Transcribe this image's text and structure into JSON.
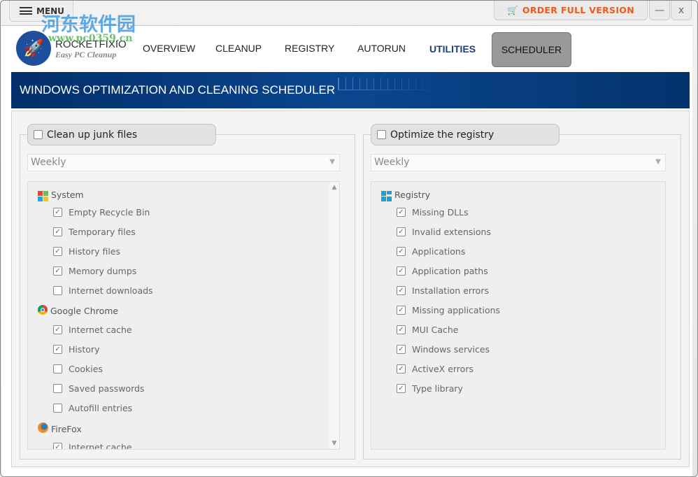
{
  "titlebar": {
    "menu_label": "MENU",
    "order_label": "ORDER FULL VERSION",
    "minimize_label": "—",
    "close_label": "x"
  },
  "watermark": {
    "text": "河东软件园",
    "url": "www.pc0359.cn"
  },
  "brand": {
    "name": "ROCKETFIXIO",
    "tagline": "Easy PC Cleanup"
  },
  "nav": [
    {
      "label": "OVERVIEW"
    },
    {
      "label": "CLEANUP"
    },
    {
      "label": "REGISTRY"
    },
    {
      "label": "AUTORUN"
    },
    {
      "label": "UTILITIES"
    },
    {
      "label": "SCHEDULER",
      "selected": true
    }
  ],
  "banner": {
    "title": "WINDOWS OPTIMIZATION AND CLEANING SCHEDULER"
  },
  "colors": {
    "accent": "#f05a1a",
    "banner": "#0a468f",
    "nav_active": "#1f3e74"
  },
  "left": {
    "label": "Clean up junk files",
    "checked": false,
    "frequency": "Weekly",
    "groups": [
      {
        "name": "System",
        "icon": "windows-icon",
        "items": [
          {
            "label": "Empty Recycle Bin",
            "checked": true
          },
          {
            "label": "Temporary files",
            "checked": true
          },
          {
            "label": "History files",
            "checked": true
          },
          {
            "label": "Memory dumps",
            "checked": true
          },
          {
            "label": "Internet downloads",
            "checked": false
          }
        ]
      },
      {
        "name": "Google Chrome",
        "icon": "chrome-icon",
        "items": [
          {
            "label": "Internet cache",
            "checked": true
          },
          {
            "label": "History",
            "checked": true
          },
          {
            "label": "Cookies",
            "checked": false
          },
          {
            "label": "Saved passwords",
            "checked": false
          },
          {
            "label": "Autofill entries",
            "checked": false
          }
        ]
      },
      {
        "name": "FireFox",
        "icon": "firefox-icon",
        "items": [
          {
            "label": "Internet cache",
            "checked": true
          }
        ]
      }
    ]
  },
  "right": {
    "label": "Optimize the registry",
    "checked": false,
    "frequency": "Weekly",
    "groups": [
      {
        "name": "Registry",
        "icon": "registry-icon",
        "items": [
          {
            "label": "Missing DLLs",
            "checked": true
          },
          {
            "label": "Invalid extensions",
            "checked": true
          },
          {
            "label": "Applications",
            "checked": true
          },
          {
            "label": "Application paths",
            "checked": true
          },
          {
            "label": "Installation errors",
            "checked": true
          },
          {
            "label": "Missing applications",
            "checked": true
          },
          {
            "label": "MUI Cache",
            "checked": true
          },
          {
            "label": "Windows services",
            "checked": true
          },
          {
            "label": "ActiveX errors",
            "checked": true
          },
          {
            "label": "Type library",
            "checked": true
          }
        ]
      }
    ]
  }
}
